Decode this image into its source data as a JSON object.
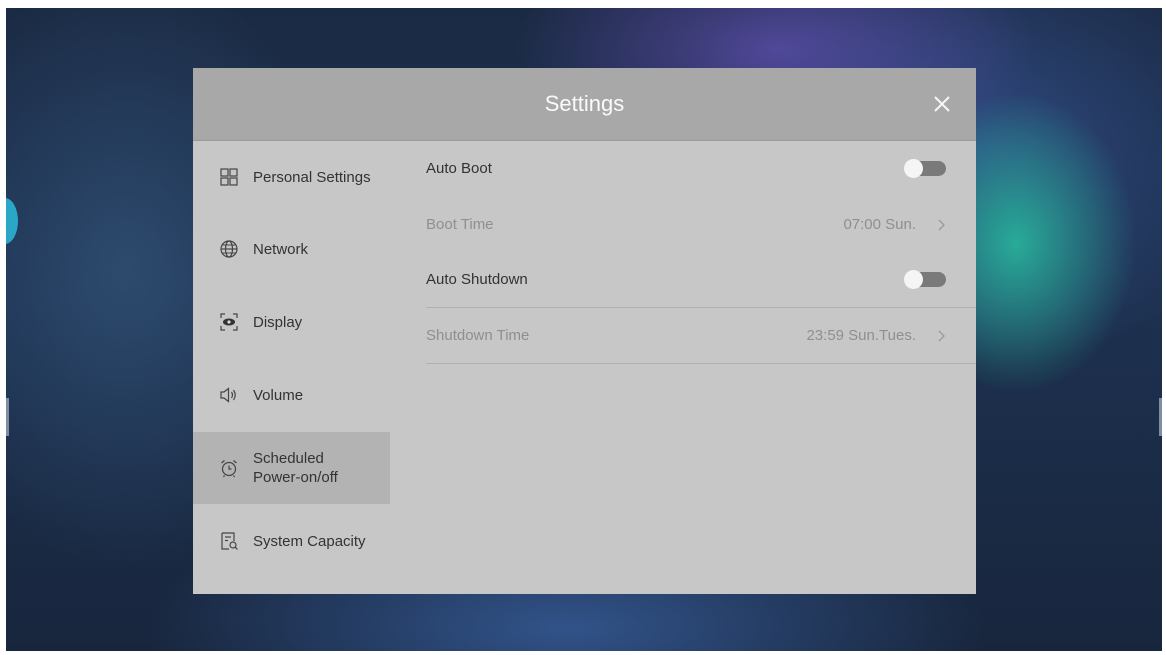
{
  "dialog": {
    "title": "Settings",
    "close_icon": "close-icon"
  },
  "sidebar": {
    "items": [
      {
        "label": "Personal Settings",
        "icon": "grid-icon",
        "active": false
      },
      {
        "label": "Network",
        "icon": "globe-icon",
        "active": false
      },
      {
        "label": "Display",
        "icon": "eye-icon",
        "active": false
      },
      {
        "label": "Volume",
        "icon": "speaker-icon",
        "active": false
      },
      {
        "label": "Scheduled\nPower-on/off",
        "icon": "alarm-clock-icon",
        "active": true
      },
      {
        "label": "System Capacity",
        "icon": "storage-icon",
        "active": false
      }
    ]
  },
  "content": {
    "auto_boot": {
      "label": "Auto Boot",
      "enabled": false
    },
    "boot_time": {
      "label": "Boot Time",
      "value": "07:00 Sun."
    },
    "auto_shutdown": {
      "label": "Auto Shutdown",
      "enabled": false
    },
    "shutdown_time": {
      "label": "Shutdown Time",
      "value": "23:59 Sun.Tues."
    }
  },
  "colors": {
    "dialog_bg": "#c7c7c7",
    "header_bg": "#a8a8a8",
    "active_item_bg": "#b3b3b3",
    "toggle_track": "#7a7a7a"
  }
}
